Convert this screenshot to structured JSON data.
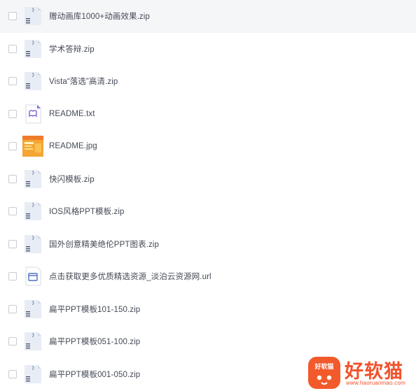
{
  "files": [
    {
      "name": "赠动画库1000+动画效果.zip",
      "icon": "zip-file-icon"
    },
    {
      "name": "学术答辩.zip",
      "icon": "zip-file-icon"
    },
    {
      "name": "Vista“落选”高清.zip",
      "icon": "zip-file-icon"
    },
    {
      "name": "README.txt",
      "icon": "text-file-icon"
    },
    {
      "name": "README.jpg",
      "icon": "image-thumbnail-icon"
    },
    {
      "name": "快闪模板.zip",
      "icon": "zip-file-icon"
    },
    {
      "name": "IOS风格PPT模板.zip",
      "icon": "zip-file-icon"
    },
    {
      "name": "国外创意精美绝伦PPT图表.zip",
      "icon": "zip-file-icon"
    },
    {
      "name": "点击获取更多优质精选资源_淡泊云资源网.url",
      "icon": "url-file-icon"
    },
    {
      "name": "扁平PPT模板101-150.zip",
      "icon": "zip-file-icon"
    },
    {
      "name": "扁平PPT模板051-100.zip",
      "icon": "zip-file-icon"
    },
    {
      "name": "扁平PPT模板001-050.zip",
      "icon": "zip-file-icon"
    }
  ],
  "hovered_index": 0,
  "watermark": {
    "badge_text": "好软猫",
    "title": "好软猫",
    "url": "www.haoruanmao.com"
  },
  "colors": {
    "row_hover_bg": "#f5f6f8",
    "text": "#444a55",
    "icon_fill": "#e8ecf5",
    "icon_detail": "#7f8ba7",
    "brand": "#f2522a"
  }
}
